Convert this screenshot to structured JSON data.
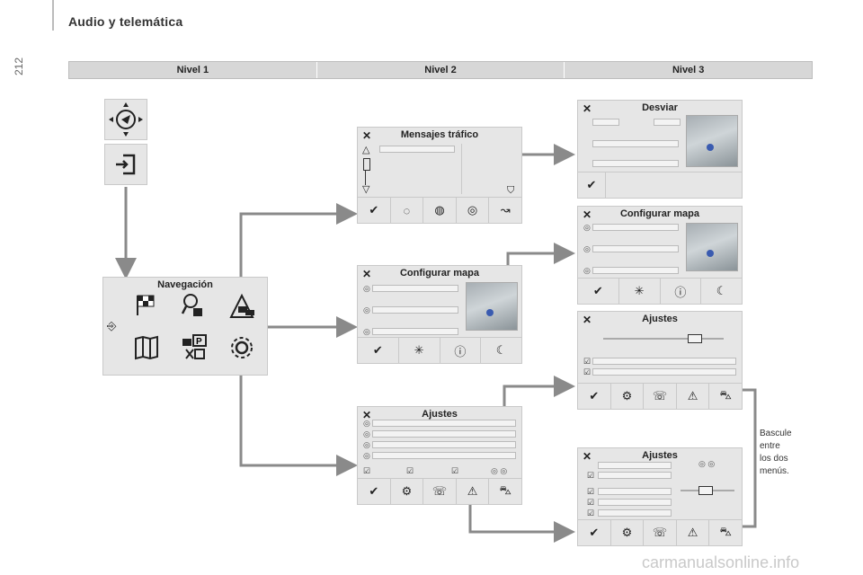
{
  "header": {
    "title": "Audio y telemática",
    "page_number": "212"
  },
  "levels": {
    "l1": "Nivel 1",
    "l2": "Nivel 2",
    "l3": "Nivel 3"
  },
  "panels": {
    "navegacion": "Navegación",
    "mensajes": "Mensajes tráfico",
    "config1": "Configurar mapa",
    "ajustes1": "Ajustes",
    "desviar": "Desviar",
    "config2": "Configurar mapa",
    "ajustes2": "Ajustes",
    "ajustes3": "Ajustes"
  },
  "note": {
    "l1": "Bascule",
    "l2": "entre",
    "l3": "los dos",
    "l4": "menús."
  },
  "watermark": "carmanualsonline.info",
  "icons": {
    "close": "✕",
    "check": "✔"
  }
}
